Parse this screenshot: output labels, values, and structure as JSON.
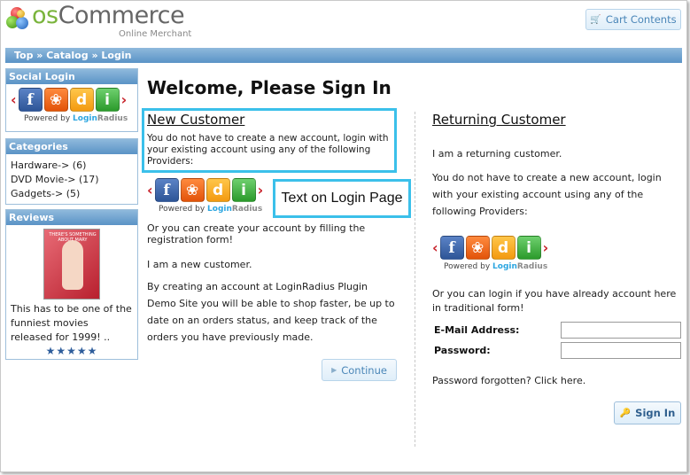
{
  "header": {
    "logo_os": "os",
    "logo_commerce": "Commerce",
    "logo_tagline": "Online Merchant",
    "cart_label": "Cart Contents"
  },
  "breadcrumb": {
    "text": "Top » Catalog » Login"
  },
  "sidebar": {
    "social_title": "Social Login",
    "powered_by": "Powered by",
    "powered_brand_login": "Login",
    "powered_brand_radius": "Radius",
    "categories_title": "Categories",
    "categories": [
      {
        "label": "Hardware-> (6)"
      },
      {
        "label": "DVD Movie-> (17)"
      },
      {
        "label": "Gadgets-> (5)"
      }
    ],
    "reviews_title": "Reviews",
    "review_text": "This has to be one of the funniest movies released for 1999! ..",
    "review_stars": "★★★★★",
    "review_image_text": "THERE'S SOMETHING ABOUT MARY"
  },
  "main": {
    "title": "Welcome, Please Sign In",
    "new_customer": {
      "heading": "New Customer",
      "intro": "You do not have to create a new account, login with your existing account using any of the following Providers:",
      "annotation": "Text on Login Page",
      "create_text": "Or you can create your account by filling the registration form!",
      "new_text": "I am a new customer.",
      "benefit_text": "By creating an account at LoginRadius Plugin Demo Site you will be able to shop faster, be up to date on an orders status, and keep track of the orders you have previously made.",
      "continue_label": "Continue"
    },
    "returning_customer": {
      "heading": "Returning Customer",
      "returning_text": "I am a returning customer.",
      "providers_text": "You do not have to create a new account, login with your existing account using any of the following Providers:",
      "traditional_text": "Or you can login if you have already account here in traditional form!",
      "email_label": "E-Mail Address:",
      "password_label": "Password:",
      "forgot_text": "Password forgotten? Click here.",
      "signin_label": "Sign In"
    }
  },
  "providers": {
    "facebook": "f",
    "blogger": "❀",
    "disqus": "d",
    "openid": "i"
  },
  "colors": {
    "accent": "#5a93c6",
    "highlight": "#3bc0ea",
    "arrow": "#c8232c"
  }
}
